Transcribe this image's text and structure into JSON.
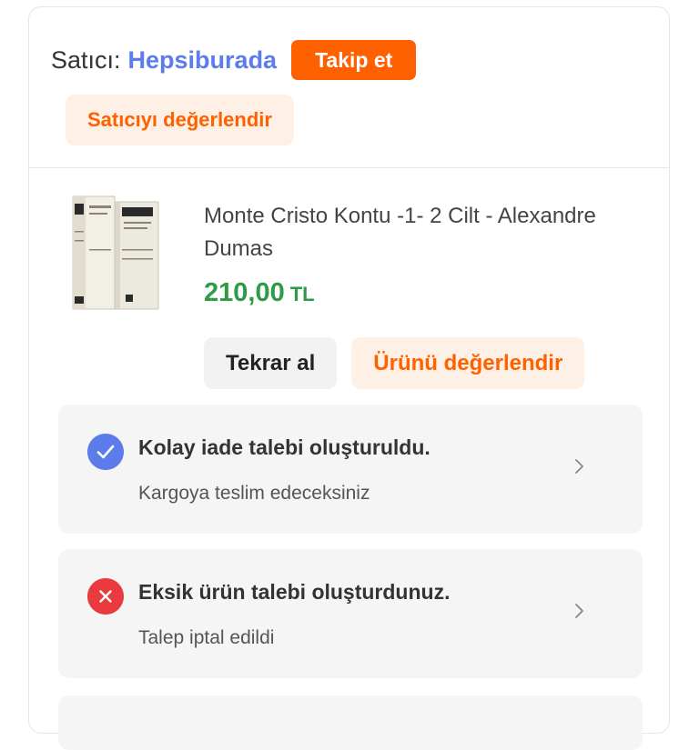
{
  "seller": {
    "prefix": "Satıcı:",
    "name": "Hepsiburada",
    "follow_label": "Takip et",
    "rate_seller_label": "Satıcıyı değerlendir"
  },
  "product": {
    "image_icon": "book-set-image",
    "title": "Monte Cristo Kontu -1- 2 Cilt - Alexandre Dumas",
    "price_amount": "210,00",
    "price_currency": "TL",
    "buy_again_label": "Tekrar al",
    "rate_product_label": "Ürünü değerlendir"
  },
  "statuses": [
    {
      "icon": "check-circle-icon",
      "title": "Kolay iade talebi oluşturuldu.",
      "subtitle": "Kargoya teslim edeceksiniz"
    },
    {
      "icon": "x-circle-icon",
      "title": "Eksik ürün talebi oluşturdunuz.",
      "subtitle": "Talep iptal edildi"
    }
  ],
  "colors": {
    "accent_orange": "#ff6000",
    "seller_blue": "#5b7cea",
    "price_green": "#2e9b46",
    "error_red": "#ea3a40"
  }
}
